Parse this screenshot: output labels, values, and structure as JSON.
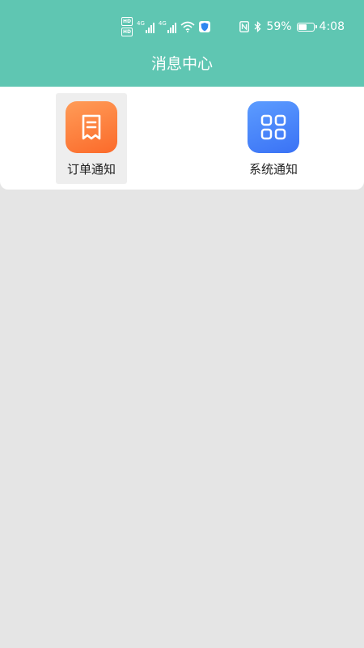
{
  "status_bar": {
    "hd_tags": [
      "HD",
      "HD"
    ],
    "signal_tags": [
      "4G",
      "4G"
    ],
    "battery_percent": "59%",
    "battery_level": 0.59,
    "time": "4:08"
  },
  "header": {
    "title": "消息中心"
  },
  "notification_types": [
    {
      "label": "订单通知",
      "icon": "receipt-icon",
      "color": "#fb7a35",
      "active": true
    },
    {
      "label": "系统通知",
      "icon": "grid-icon",
      "color": "#4a84f8",
      "active": false
    }
  ],
  "colors": {
    "header_bg": "#5fc6b2",
    "page_bg": "#e5e5e5",
    "panel_bg": "#ffffff"
  }
}
